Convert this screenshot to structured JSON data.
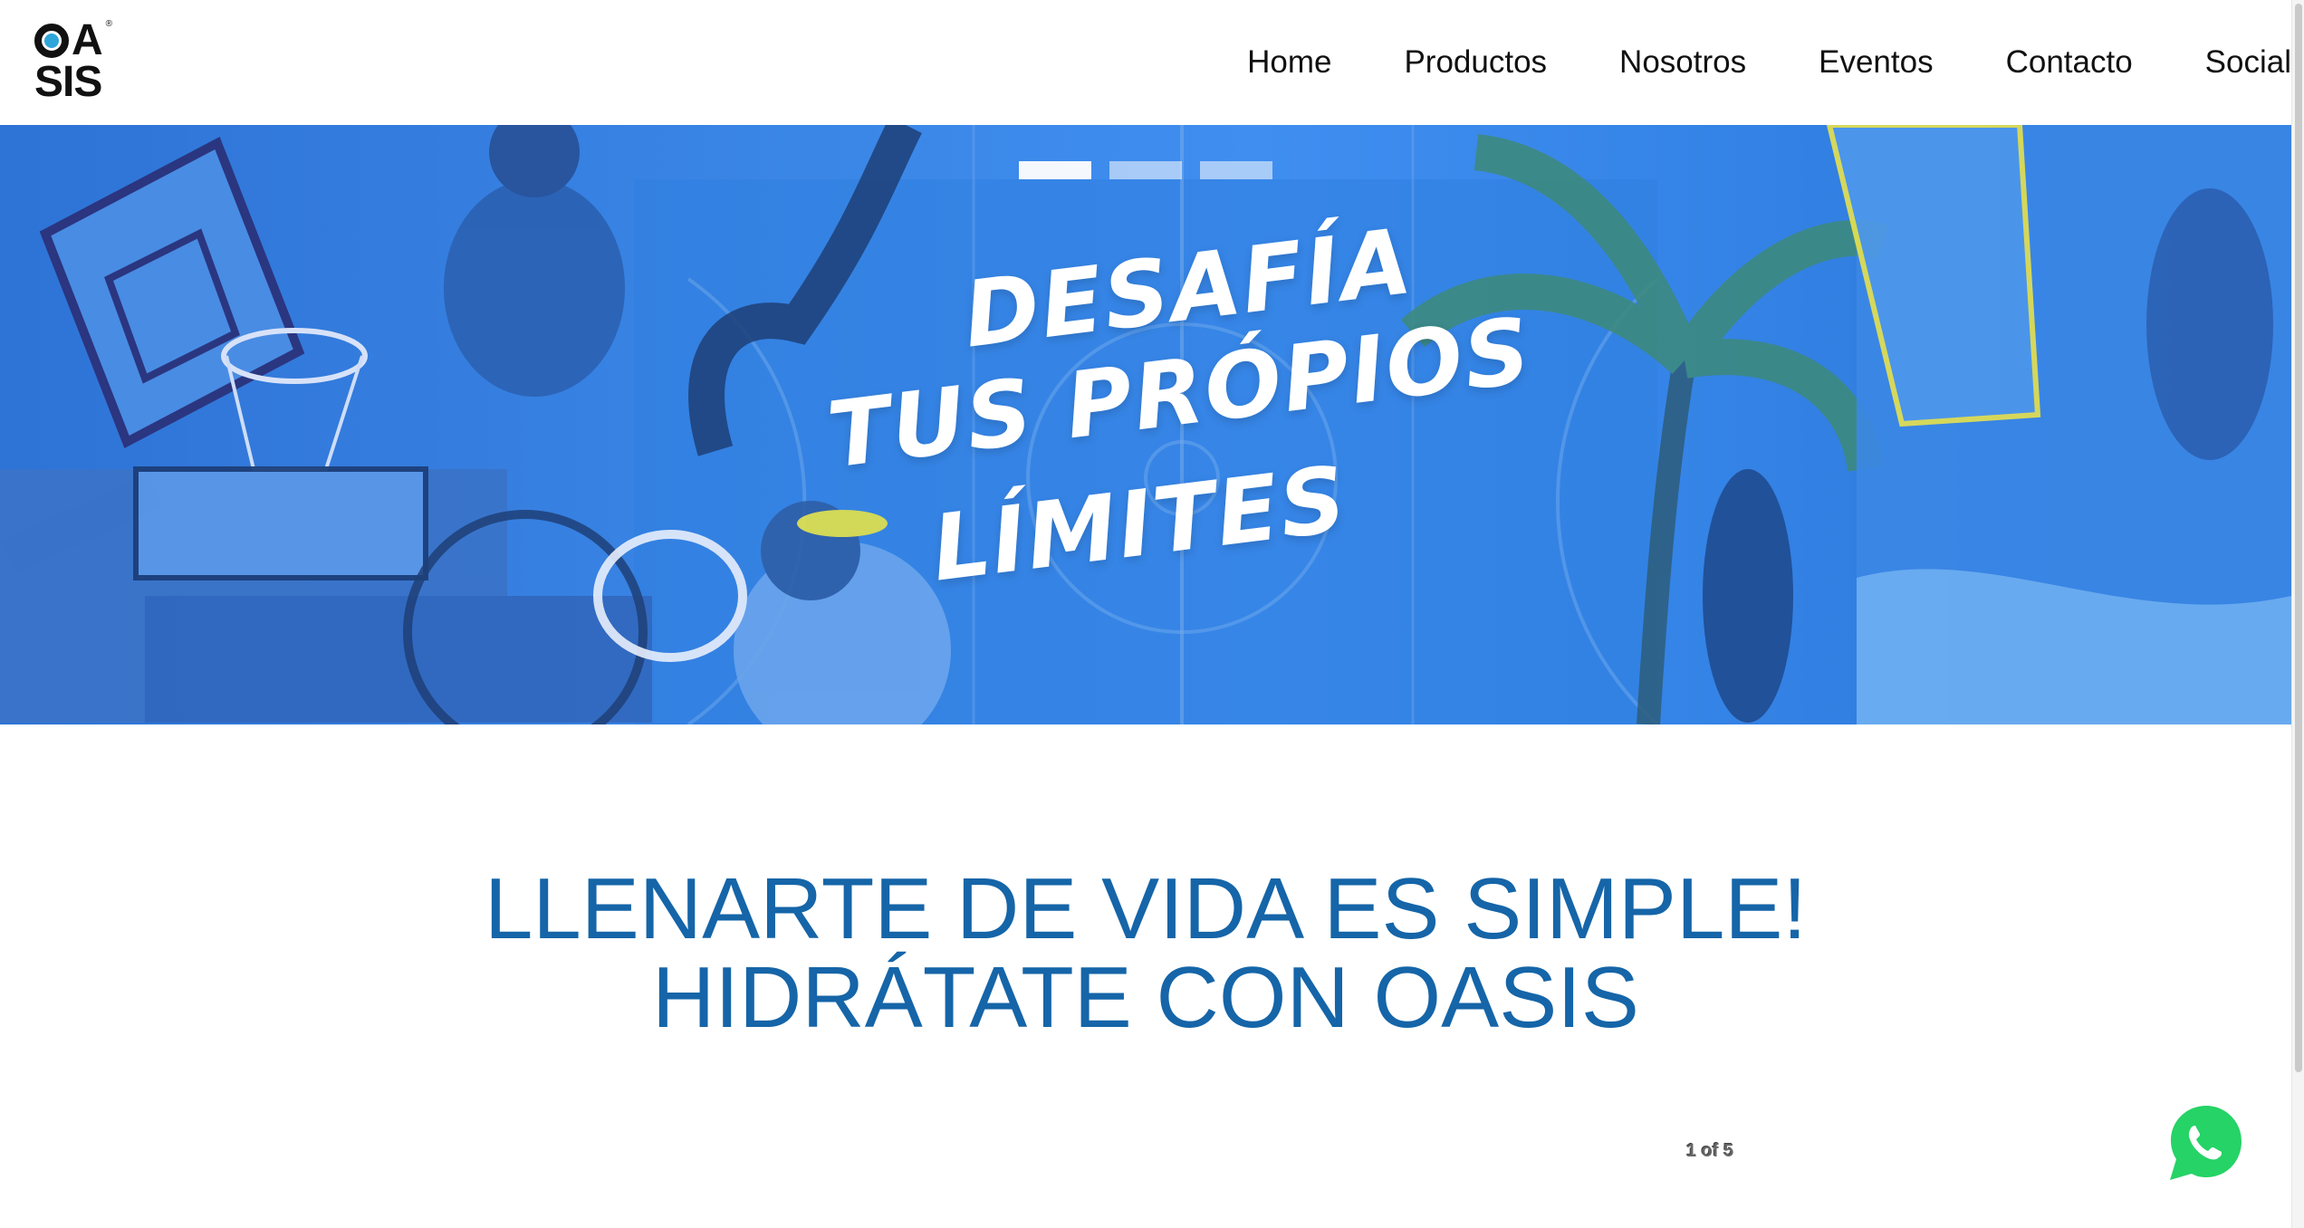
{
  "logo": {
    "top_text": "A",
    "bottom_text": "SIS",
    "registered_mark": "®",
    "accent_color": "#2fa6d9"
  },
  "nav": {
    "items": [
      {
        "label": "Home"
      },
      {
        "label": "Productos"
      },
      {
        "label": "Nosotros"
      },
      {
        "label": "Eventos"
      },
      {
        "label": "Contacto"
      },
      {
        "label": "Social"
      }
    ]
  },
  "hero": {
    "headline_lines": [
      "DESAFÍA",
      "TUS PRÓPIOS",
      "LÍMITES"
    ],
    "indicators": [
      {
        "state": "active"
      },
      {
        "state": "inactive"
      },
      {
        "state": "inactive"
      }
    ],
    "tint_color": "#3a86e6"
  },
  "slogan": {
    "line1": "LLENARTE DE VIDA ES SIMPLE!",
    "line2": "HIDRÁTATE CON OASIS",
    "color": "#1565a8"
  },
  "counter": {
    "text": "1 of 5"
  },
  "whatsapp": {
    "icon": "whatsapp-icon",
    "color": "#25d366"
  }
}
